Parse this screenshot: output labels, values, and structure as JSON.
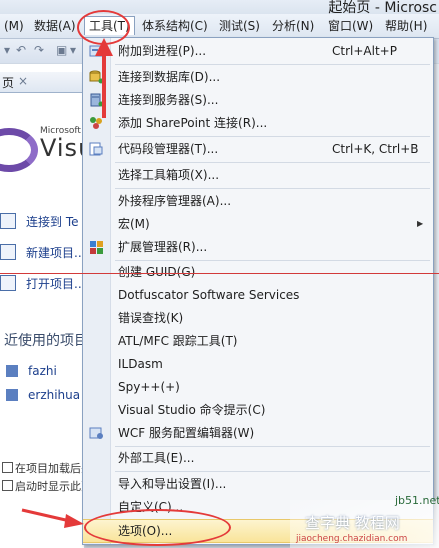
{
  "window": {
    "title": "起始页 - Microsc"
  },
  "menubar": {
    "items": [
      {
        "label": "(M)"
      },
      {
        "label": "数据(A)"
      },
      {
        "label": "工具(T)"
      },
      {
        "label": "体系结构(C)"
      },
      {
        "label": "测试(S)"
      },
      {
        "label": "分析(N)"
      },
      {
        "label": "窗口(W)"
      },
      {
        "label": "帮助(H)"
      }
    ]
  },
  "start_page": {
    "tab_label": "页",
    "tab_close": "×",
    "logo_small": "Microsoft",
    "logo_big": "Visu",
    "links": [
      {
        "label": "连接到 Te"
      },
      {
        "label": "新建项目..."
      },
      {
        "label": "打开项目..."
      }
    ],
    "recent_heading": "近使用的项目",
    "recent_projects": [
      {
        "label": "fazhi"
      },
      {
        "label": "erzhihua"
      }
    ],
    "notes": [
      "在项目加载后关",
      "启动时显示此页"
    ]
  },
  "tools_menu": {
    "items": [
      {
        "label": "附加到进程(P)...",
        "shortcut": "Ctrl+Alt+P",
        "icon": "attach-process-icon"
      },
      {
        "label": "连接到数据库(D)...",
        "shortcut": "",
        "icon": "database-icon"
      },
      {
        "label": "连接到服务器(S)...",
        "shortcut": "",
        "icon": "server-icon"
      },
      {
        "label": "添加 SharePoint 连接(R)...",
        "shortcut": "",
        "icon": "sharepoint-icon"
      },
      {
        "label": "代码段管理器(T)...",
        "shortcut": "Ctrl+K, Ctrl+B",
        "icon": "snippet-icon"
      },
      {
        "label": "选择工具箱项(X)...",
        "shortcut": "",
        "icon": ""
      },
      {
        "label": "外接程序管理器(A)...",
        "shortcut": "",
        "icon": ""
      },
      {
        "label": "宏(M)",
        "shortcut": "",
        "icon": "",
        "submenu": true
      },
      {
        "label": "扩展管理器(R)...",
        "shortcut": "",
        "icon": "extension-icon"
      },
      {
        "label": "创建 GUID(G)",
        "shortcut": "",
        "icon": ""
      },
      {
        "label": "Dotfuscator Software Services",
        "shortcut": "",
        "icon": ""
      },
      {
        "label": "错误查找(K)",
        "shortcut": "",
        "icon": ""
      },
      {
        "label": "ATL/MFC 跟踪工具(T)",
        "shortcut": "",
        "icon": ""
      },
      {
        "label": "ILDasm",
        "shortcut": "",
        "icon": ""
      },
      {
        "label": "Spy++(+)",
        "shortcut": "",
        "icon": ""
      },
      {
        "label": "Visual Studio 命令提示(C)",
        "shortcut": "",
        "icon": ""
      },
      {
        "label": "WCF 服务配置编辑器(W)",
        "shortcut": "",
        "icon": "wcf-icon"
      },
      {
        "label": "外部工具(E)...",
        "shortcut": "",
        "icon": ""
      },
      {
        "label": "导入和导出设置(I)...",
        "shortcut": "",
        "icon": ""
      },
      {
        "label": "自定义(C)...",
        "shortcut": "",
        "icon": ""
      },
      {
        "label": "选项(O)...",
        "shortcut": "",
        "icon": "",
        "highlighted": true
      }
    ],
    "submenu_arrow": "▶"
  },
  "watermark": {
    "line1": "查字典 教程网",
    "line2": "jiaocheng.chazidian.com",
    "line3": "jb51.net"
  },
  "colors": {
    "annotation_red": "#e43a3a",
    "highlight": "#f9e49a",
    "link_blue": "#1c3f8c"
  }
}
